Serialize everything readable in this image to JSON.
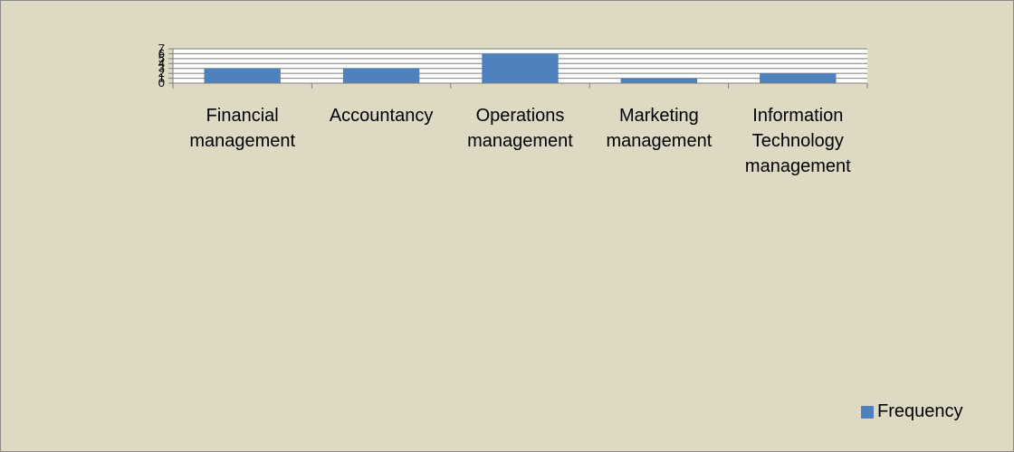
{
  "chart_data": {
    "type": "bar",
    "categories": [
      [
        "Financial",
        "management"
      ],
      [
        "Accountancy"
      ],
      [
        "Operations",
        "management"
      ],
      [
        "Marketing",
        "management"
      ],
      [
        "Information",
        "Technology",
        "management"
      ]
    ],
    "series": [
      {
        "name": "Frequency",
        "values": [
          3,
          3,
          6,
          1,
          2
        ],
        "color": "#4f81bd"
      }
    ],
    "yticks": [
      "0",
      "1",
      "2",
      "3",
      "4",
      "5",
      "6",
      "7"
    ],
    "ylim": [
      0,
      7
    ],
    "grid": true,
    "legend_position": "bottom-right"
  }
}
